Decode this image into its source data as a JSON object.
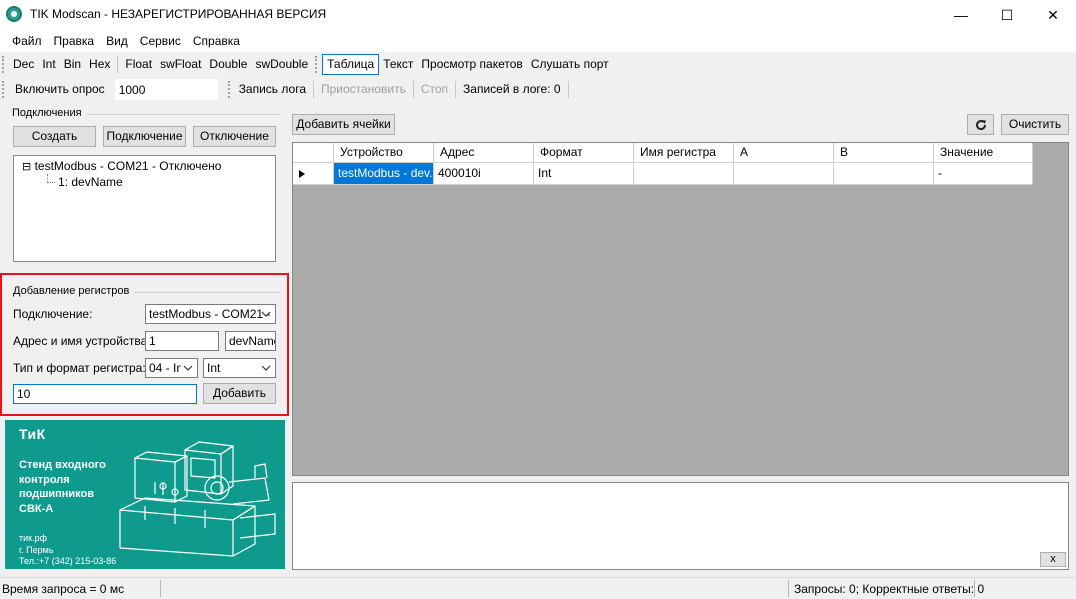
{
  "window": {
    "title": "TIK Modscan - НЕЗАРЕГИСТРИРОВАННАЯ ВЕРСИЯ",
    "minimize": "—",
    "maximize": "☐",
    "close": "✕"
  },
  "menu": [
    "Файл",
    "Правка",
    "Вид",
    "Сервис",
    "Справка"
  ],
  "toolbar1": {
    "formats": [
      "Dec",
      "Int",
      "Bin",
      "Hex"
    ],
    "floats": [
      "Float",
      "swFloat",
      "Double",
      "swDouble"
    ],
    "views": [
      "Таблица",
      "Текст",
      "Просмотр пакетов",
      "Слушать порт"
    ],
    "active_view": "Таблица"
  },
  "toolbar2": {
    "polling_label": "Включить опрос",
    "polling_value": "1000",
    "log_label": "Запись лога",
    "pause_label": "Приостановить",
    "stop_label": "Стоп",
    "log_count": "Записей в логе: 0"
  },
  "connections": {
    "title": "Подключения",
    "create": "Создать",
    "connect": "Подключение",
    "disconnect": "Отключение",
    "tree_root": "testModbus - COM21 - Отключено",
    "tree_child": "1: devName",
    "expand_glyph": "⊟"
  },
  "add_registers": {
    "title": "Добавление регистров",
    "connection_label": "Подключение:",
    "connection_value": "testModbus - COM21 -",
    "address_label": "Адрес и имя устройства:",
    "address_value": "1",
    "device_name_value": "devName",
    "type_label": "Тип и формат регистра:",
    "type_value": "04 - In",
    "format_value": "Int",
    "register_value": "10",
    "add_button": "Добавить"
  },
  "banner": {
    "logo": "ТиК",
    "headline_1": "Стенд входного",
    "headline_2": "контроля",
    "headline_3": "подшипников",
    "headline_4": "СВК-А",
    "site": "тик.рф",
    "city": "г. Пермь",
    "phone": "Тел.:+7 (342) 215-03-86"
  },
  "grid_toolbar": {
    "add_cells": "Добавить ячейки",
    "clear": "Очистить"
  },
  "grid": {
    "columns": [
      "Устройство",
      "Адрес",
      "Формат",
      "Имя регистра",
      "A",
      "B",
      "Значение"
    ],
    "rows": [
      [
        "testModbus - dev...",
        "400010i",
        "Int",
        "",
        "",
        "",
        "-"
      ]
    ]
  },
  "log": {
    "close": "x"
  },
  "status": {
    "left": "Время запроса = 0 мс",
    "right": "Запросы: 0; Корректные ответы: 0"
  },
  "colors": {
    "accent": "#0078d7",
    "highlight_box": "#e8141a",
    "banner_bg": "#0e9b8e"
  }
}
